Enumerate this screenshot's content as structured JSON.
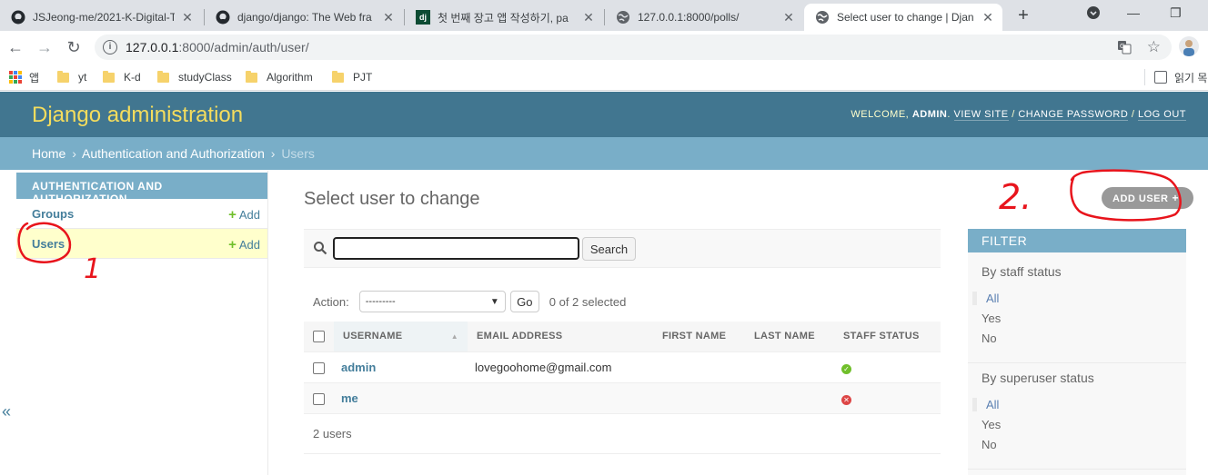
{
  "browser": {
    "tabs": [
      {
        "title": "JSJeong-me/2021-K-Digital-T",
        "icon": "github-icon"
      },
      {
        "title": "django/django: The Web fra",
        "icon": "github-icon"
      },
      {
        "title": "첫 번째 장고 앱 작성하기, pa",
        "icon": "django-icon",
        "favicon_text": "dj"
      },
      {
        "title": "127.0.0.1:8000/polls/",
        "icon": "globe-icon"
      },
      {
        "title": "Select user to change | Djan",
        "icon": "globe-icon",
        "active": true
      }
    ],
    "url_host": "127.0.0.1",
    "url_path": ":8000/admin/auth/user/",
    "bookmarks": [
      {
        "label": "앱",
        "icon": "apps-grid-icon"
      },
      {
        "label": "yt",
        "icon": "folder-icon"
      },
      {
        "label": "K-d",
        "icon": "folder-icon"
      },
      {
        "label": "studyClass",
        "icon": "folder-icon"
      },
      {
        "label": "Algorithm",
        "icon": "folder-icon"
      },
      {
        "label": "PJT",
        "icon": "folder-icon"
      }
    ],
    "reading_list": "읽기 목"
  },
  "admin": {
    "site_name": "Django administration",
    "welcome": "WELCOME,",
    "user": "ADMIN",
    "view_site": "VIEW SITE",
    "change_password": "CHANGE PASSWORD",
    "log_out": "LOG OUT",
    "slash": "/",
    "breadcrumbs": {
      "home": "Home",
      "app": "Authentication and Authorization",
      "current": "Users",
      "sep": "›"
    },
    "sidebar": {
      "caption": "AUTHENTICATION AND AUTHORIZATION",
      "models": [
        {
          "name": "Groups",
          "add": "Add"
        },
        {
          "name": "Users",
          "add": "Add",
          "current": true
        }
      ],
      "toggle": "«"
    },
    "title": "Select user to change",
    "add_user": "ADD USER",
    "search_button": "Search",
    "search_value": "",
    "action_label": "Action:",
    "action_selected": "---------",
    "go": "Go",
    "selected_counter": "0 of 2 selected",
    "columns": [
      "USERNAME",
      "EMAIL ADDRESS",
      "FIRST NAME",
      "LAST NAME",
      "STAFF STATUS"
    ],
    "rows": [
      {
        "username": "admin",
        "email": "lovegoohome@gmail.com",
        "first_name": "",
        "last_name": "",
        "staff": true
      },
      {
        "username": "me",
        "email": "",
        "first_name": "",
        "last_name": "",
        "staff": false
      }
    ],
    "paginator": "2 users",
    "filter": {
      "title": "FILTER",
      "groups": [
        {
          "heading": "By staff status",
          "options": [
            "All",
            "Yes",
            "No"
          ],
          "selected": "All"
        },
        {
          "heading": "By superuser status",
          "options": [
            "All",
            "Yes",
            "No"
          ],
          "selected": "All"
        }
      ]
    }
  },
  "annotations": {
    "label_1": "1",
    "label_2": "2.",
    "color": "#e8141c"
  }
}
